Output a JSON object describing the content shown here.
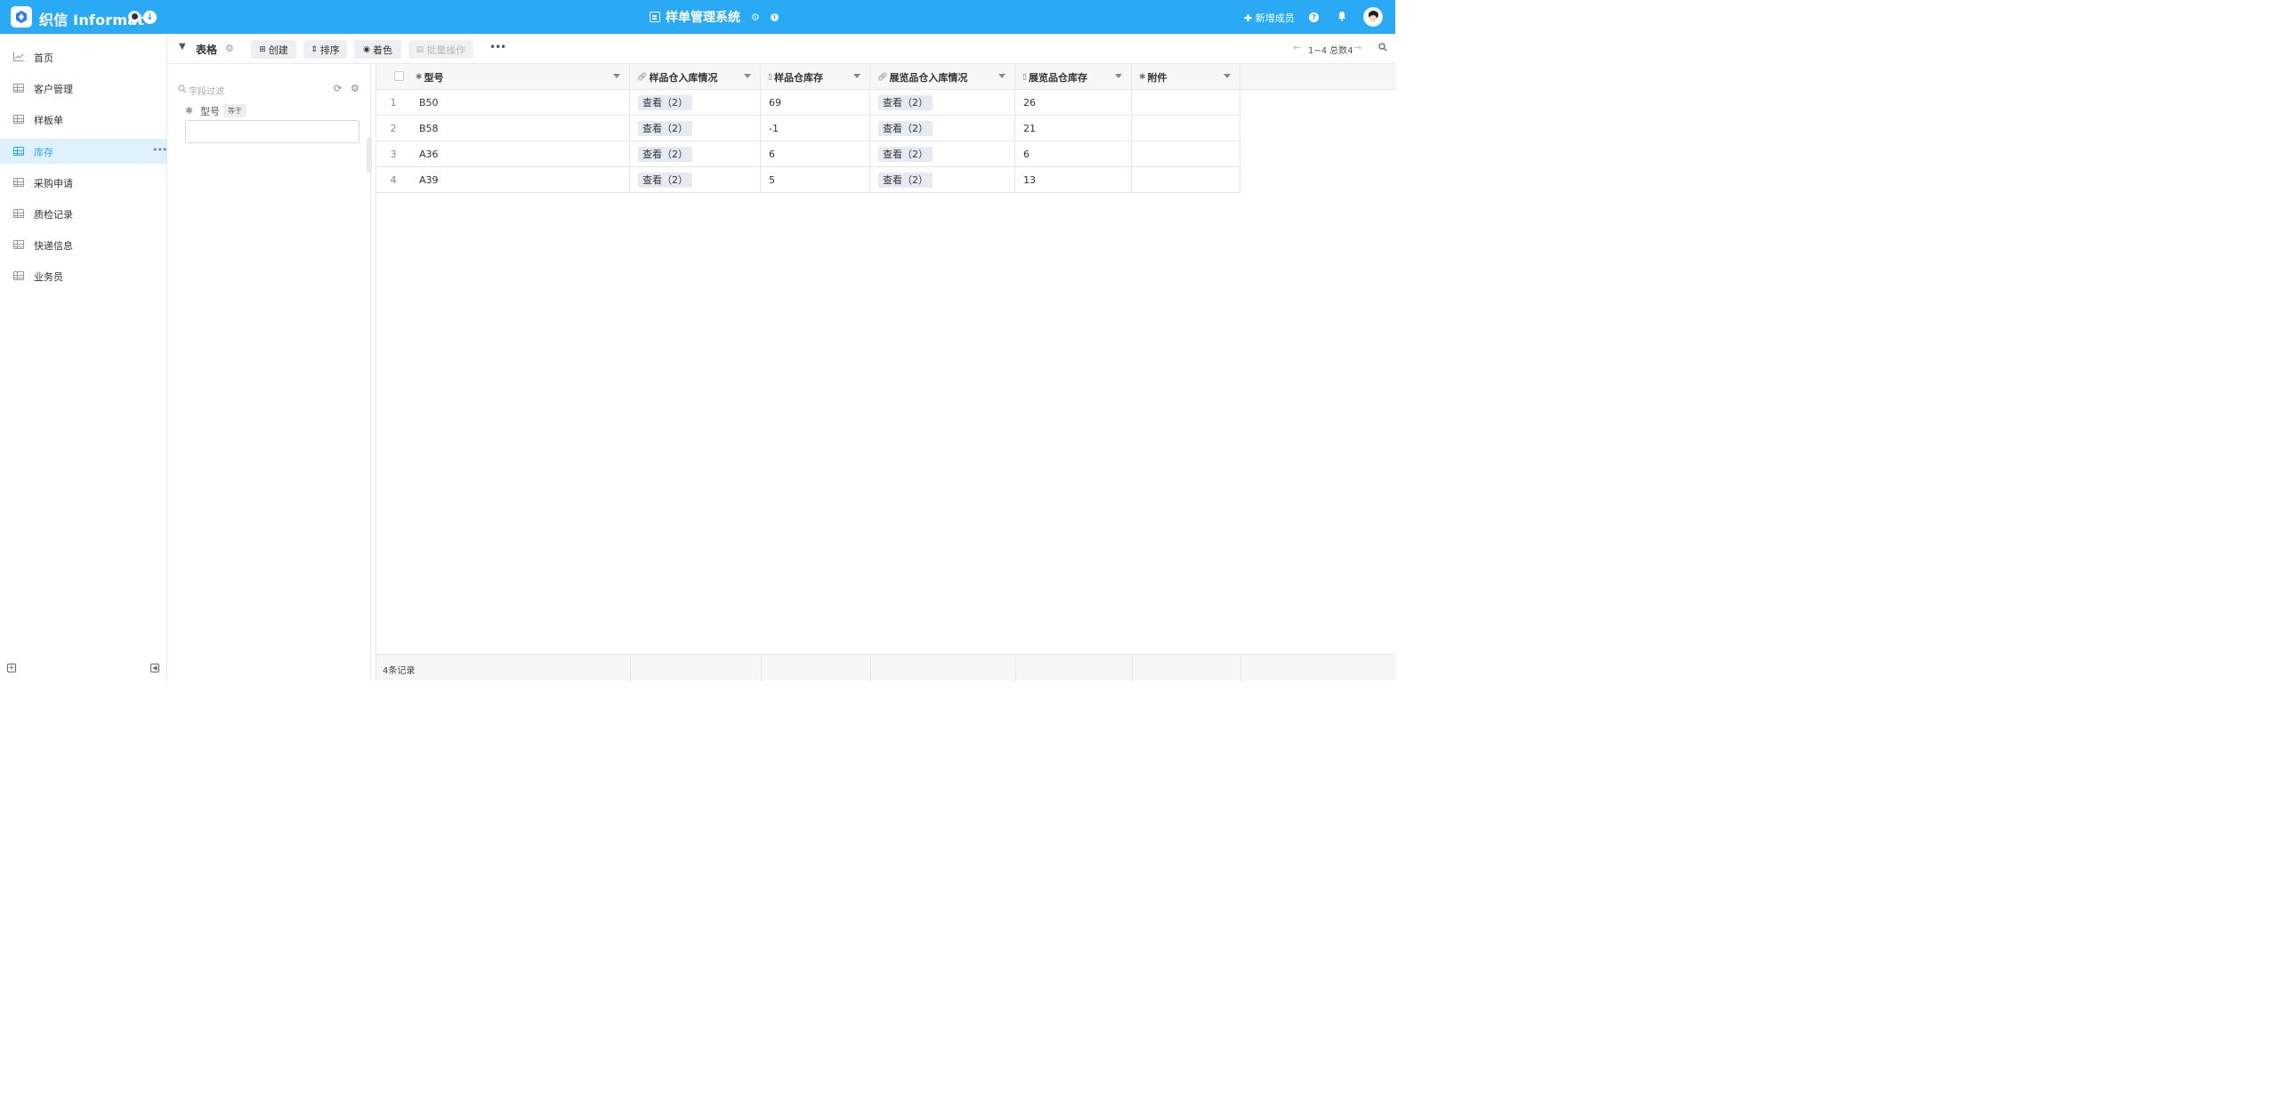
{
  "topbar": {
    "logo_text": "织信 Informat",
    "app_title": "样单管理系统",
    "add_member_label": "新增成员",
    "colors": {
      "bar": "#2aa9f5",
      "accent": "#2aa9f5"
    },
    "icons": [
      "app-logo-icon",
      "avatar",
      "download-circle-icon",
      "app-grid-icon",
      "gear-icon",
      "info-icon",
      "plus-icon",
      "help-icon",
      "bell-icon"
    ]
  },
  "sidebar": {
    "items": [
      {
        "label": "首页",
        "icon": "chart-line-icon",
        "active": false
      },
      {
        "label": "客户管理",
        "icon": "table-icon",
        "active": false
      },
      {
        "label": "样板单",
        "icon": "table-icon",
        "active": false
      },
      {
        "label": "库存",
        "icon": "table-icon",
        "active": true
      },
      {
        "label": "采购申请",
        "icon": "table-icon",
        "active": false
      },
      {
        "label": "质检记录",
        "icon": "table-icon",
        "active": false
      },
      {
        "label": "快递信息",
        "icon": "table-icon",
        "active": false
      },
      {
        "label": "业务员",
        "icon": "table-icon",
        "active": false
      }
    ],
    "more_label": "•••"
  },
  "toolbar": {
    "view_label": "表格",
    "create_label": "创建",
    "sort_label": "排序",
    "color_label": "着色",
    "batch_label": "批量操作",
    "more_label": "•••",
    "pagination": "1~4 总数4"
  },
  "filter": {
    "search_placeholder": "字段过滤",
    "field_label": "型号",
    "operator": "等于",
    "value": ""
  },
  "table": {
    "columns": [
      {
        "label": "型号",
        "icon": "asterisk-icon"
      },
      {
        "label": "样品仓入库情况",
        "icon": "link-icon"
      },
      {
        "label": "样品仓库存",
        "icon": "formula-icon"
      },
      {
        "label": "展览品仓入库情况",
        "icon": "link-icon"
      },
      {
        "label": "展览品仓库存",
        "icon": "formula-icon"
      },
      {
        "label": "附件",
        "icon": "asterisk-icon"
      }
    ],
    "rows": [
      {
        "num": "1",
        "model": "B50",
        "sample_in": "查看（2）",
        "sample_stock": "69",
        "exhibit_in": "查看（2）",
        "exhibit_stock": "26",
        "attachment": ""
      },
      {
        "num": "2",
        "model": "B58",
        "sample_in": "查看（2）",
        "sample_stock": "-1",
        "exhibit_in": "查看（2）",
        "exhibit_stock": "21",
        "attachment": ""
      },
      {
        "num": "3",
        "model": "A36",
        "sample_in": "查看（2）",
        "sample_stock": "6",
        "exhibit_in": "查看（2）",
        "exhibit_stock": "6",
        "attachment": ""
      },
      {
        "num": "4",
        "model": "A39",
        "sample_in": "查看（2）",
        "sample_stock": "5",
        "exhibit_in": "查看（2）",
        "exhibit_stock": "13",
        "attachment": ""
      }
    ],
    "footer_count": "4条记录"
  }
}
